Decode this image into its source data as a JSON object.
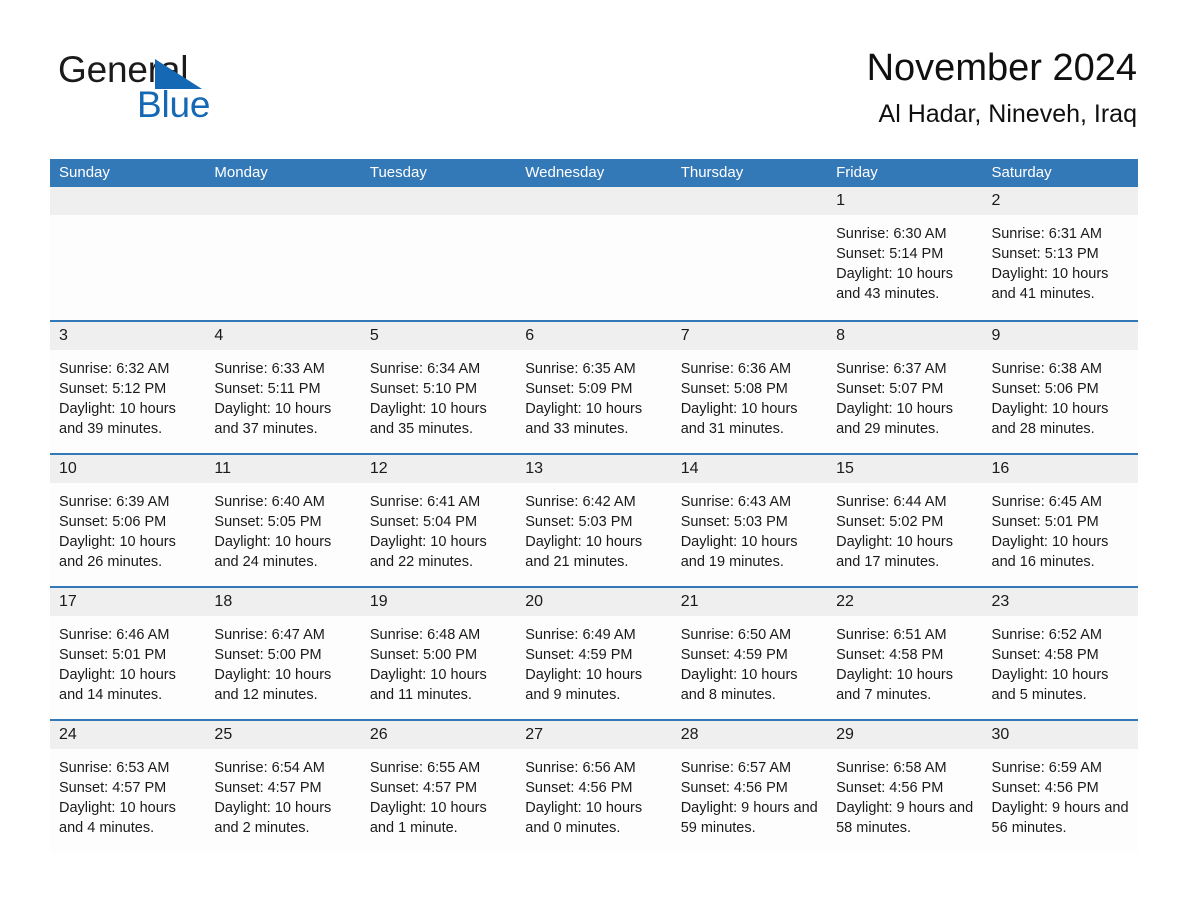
{
  "brand": {
    "name_part1": "General",
    "name_part2": "Blue",
    "flag_icon": "triangle-flag-icon",
    "accent_color": "#1569b4"
  },
  "header": {
    "title": "November 2024",
    "subtitle": "Al Hadar, Nineveh, Iraq"
  },
  "theme": {
    "header_blue": "#3479b7",
    "date_band_gray": "#efefef",
    "cell_white": "#fdfdfd"
  },
  "calendar": {
    "weekdays": [
      "Sunday",
      "Monday",
      "Tuesday",
      "Wednesday",
      "Thursday",
      "Friday",
      "Saturday"
    ],
    "weeks": [
      [
        {
          "blank": true
        },
        {
          "blank": true
        },
        {
          "blank": true
        },
        {
          "blank": true
        },
        {
          "blank": true
        },
        {
          "day": "1",
          "sunrise": "Sunrise: 6:30 AM",
          "sunset": "Sunset: 5:14 PM",
          "daylight": "Daylight: 10 hours and 43 minutes."
        },
        {
          "day": "2",
          "sunrise": "Sunrise: 6:31 AM",
          "sunset": "Sunset: 5:13 PM",
          "daylight": "Daylight: 10 hours and 41 minutes."
        }
      ],
      [
        {
          "day": "3",
          "sunrise": "Sunrise: 6:32 AM",
          "sunset": "Sunset: 5:12 PM",
          "daylight": "Daylight: 10 hours and 39 minutes."
        },
        {
          "day": "4",
          "sunrise": "Sunrise: 6:33 AM",
          "sunset": "Sunset: 5:11 PM",
          "daylight": "Daylight: 10 hours and 37 minutes."
        },
        {
          "day": "5",
          "sunrise": "Sunrise: 6:34 AM",
          "sunset": "Sunset: 5:10 PM",
          "daylight": "Daylight: 10 hours and 35 minutes."
        },
        {
          "day": "6",
          "sunrise": "Sunrise: 6:35 AM",
          "sunset": "Sunset: 5:09 PM",
          "daylight": "Daylight: 10 hours and 33 minutes."
        },
        {
          "day": "7",
          "sunrise": "Sunrise: 6:36 AM",
          "sunset": "Sunset: 5:08 PM",
          "daylight": "Daylight: 10 hours and 31 minutes."
        },
        {
          "day": "8",
          "sunrise": "Sunrise: 6:37 AM",
          "sunset": "Sunset: 5:07 PM",
          "daylight": "Daylight: 10 hours and 29 minutes."
        },
        {
          "day": "9",
          "sunrise": "Sunrise: 6:38 AM",
          "sunset": "Sunset: 5:06 PM",
          "daylight": "Daylight: 10 hours and 28 minutes."
        }
      ],
      [
        {
          "day": "10",
          "sunrise": "Sunrise: 6:39 AM",
          "sunset": "Sunset: 5:06 PM",
          "daylight": "Daylight: 10 hours and 26 minutes."
        },
        {
          "day": "11",
          "sunrise": "Sunrise: 6:40 AM",
          "sunset": "Sunset: 5:05 PM",
          "daylight": "Daylight: 10 hours and 24 minutes."
        },
        {
          "day": "12",
          "sunrise": "Sunrise: 6:41 AM",
          "sunset": "Sunset: 5:04 PM",
          "daylight": "Daylight: 10 hours and 22 minutes."
        },
        {
          "day": "13",
          "sunrise": "Sunrise: 6:42 AM",
          "sunset": "Sunset: 5:03 PM",
          "daylight": "Daylight: 10 hours and 21 minutes."
        },
        {
          "day": "14",
          "sunrise": "Sunrise: 6:43 AM",
          "sunset": "Sunset: 5:03 PM",
          "daylight": "Daylight: 10 hours and 19 minutes."
        },
        {
          "day": "15",
          "sunrise": "Sunrise: 6:44 AM",
          "sunset": "Sunset: 5:02 PM",
          "daylight": "Daylight: 10 hours and 17 minutes."
        },
        {
          "day": "16",
          "sunrise": "Sunrise: 6:45 AM",
          "sunset": "Sunset: 5:01 PM",
          "daylight": "Daylight: 10 hours and 16 minutes."
        }
      ],
      [
        {
          "day": "17",
          "sunrise": "Sunrise: 6:46 AM",
          "sunset": "Sunset: 5:01 PM",
          "daylight": "Daylight: 10 hours and 14 minutes."
        },
        {
          "day": "18",
          "sunrise": "Sunrise: 6:47 AM",
          "sunset": "Sunset: 5:00 PM",
          "daylight": "Daylight: 10 hours and 12 minutes."
        },
        {
          "day": "19",
          "sunrise": "Sunrise: 6:48 AM",
          "sunset": "Sunset: 5:00 PM",
          "daylight": "Daylight: 10 hours and 11 minutes."
        },
        {
          "day": "20",
          "sunrise": "Sunrise: 6:49 AM",
          "sunset": "Sunset: 4:59 PM",
          "daylight": "Daylight: 10 hours and 9 minutes."
        },
        {
          "day": "21",
          "sunrise": "Sunrise: 6:50 AM",
          "sunset": "Sunset: 4:59 PM",
          "daylight": "Daylight: 10 hours and 8 minutes."
        },
        {
          "day": "22",
          "sunrise": "Sunrise: 6:51 AM",
          "sunset": "Sunset: 4:58 PM",
          "daylight": "Daylight: 10 hours and 7 minutes."
        },
        {
          "day": "23",
          "sunrise": "Sunrise: 6:52 AM",
          "sunset": "Sunset: 4:58 PM",
          "daylight": "Daylight: 10 hours and 5 minutes."
        }
      ],
      [
        {
          "day": "24",
          "sunrise": "Sunrise: 6:53 AM",
          "sunset": "Sunset: 4:57 PM",
          "daylight": "Daylight: 10 hours and 4 minutes."
        },
        {
          "day": "25",
          "sunrise": "Sunrise: 6:54 AM",
          "sunset": "Sunset: 4:57 PM",
          "daylight": "Daylight: 10 hours and 2 minutes."
        },
        {
          "day": "26",
          "sunrise": "Sunrise: 6:55 AM",
          "sunset": "Sunset: 4:57 PM",
          "daylight": "Daylight: 10 hours and 1 minute."
        },
        {
          "day": "27",
          "sunrise": "Sunrise: 6:56 AM",
          "sunset": "Sunset: 4:56 PM",
          "daylight": "Daylight: 10 hours and 0 minutes."
        },
        {
          "day": "28",
          "sunrise": "Sunrise: 6:57 AM",
          "sunset": "Sunset: 4:56 PM",
          "daylight": "Daylight: 9 hours and 59 minutes."
        },
        {
          "day": "29",
          "sunrise": "Sunrise: 6:58 AM",
          "sunset": "Sunset: 4:56 PM",
          "daylight": "Daylight: 9 hours and 58 minutes."
        },
        {
          "day": "30",
          "sunrise": "Sunrise: 6:59 AM",
          "sunset": "Sunset: 4:56 PM",
          "daylight": "Daylight: 9 hours and 56 minutes."
        }
      ]
    ]
  }
}
